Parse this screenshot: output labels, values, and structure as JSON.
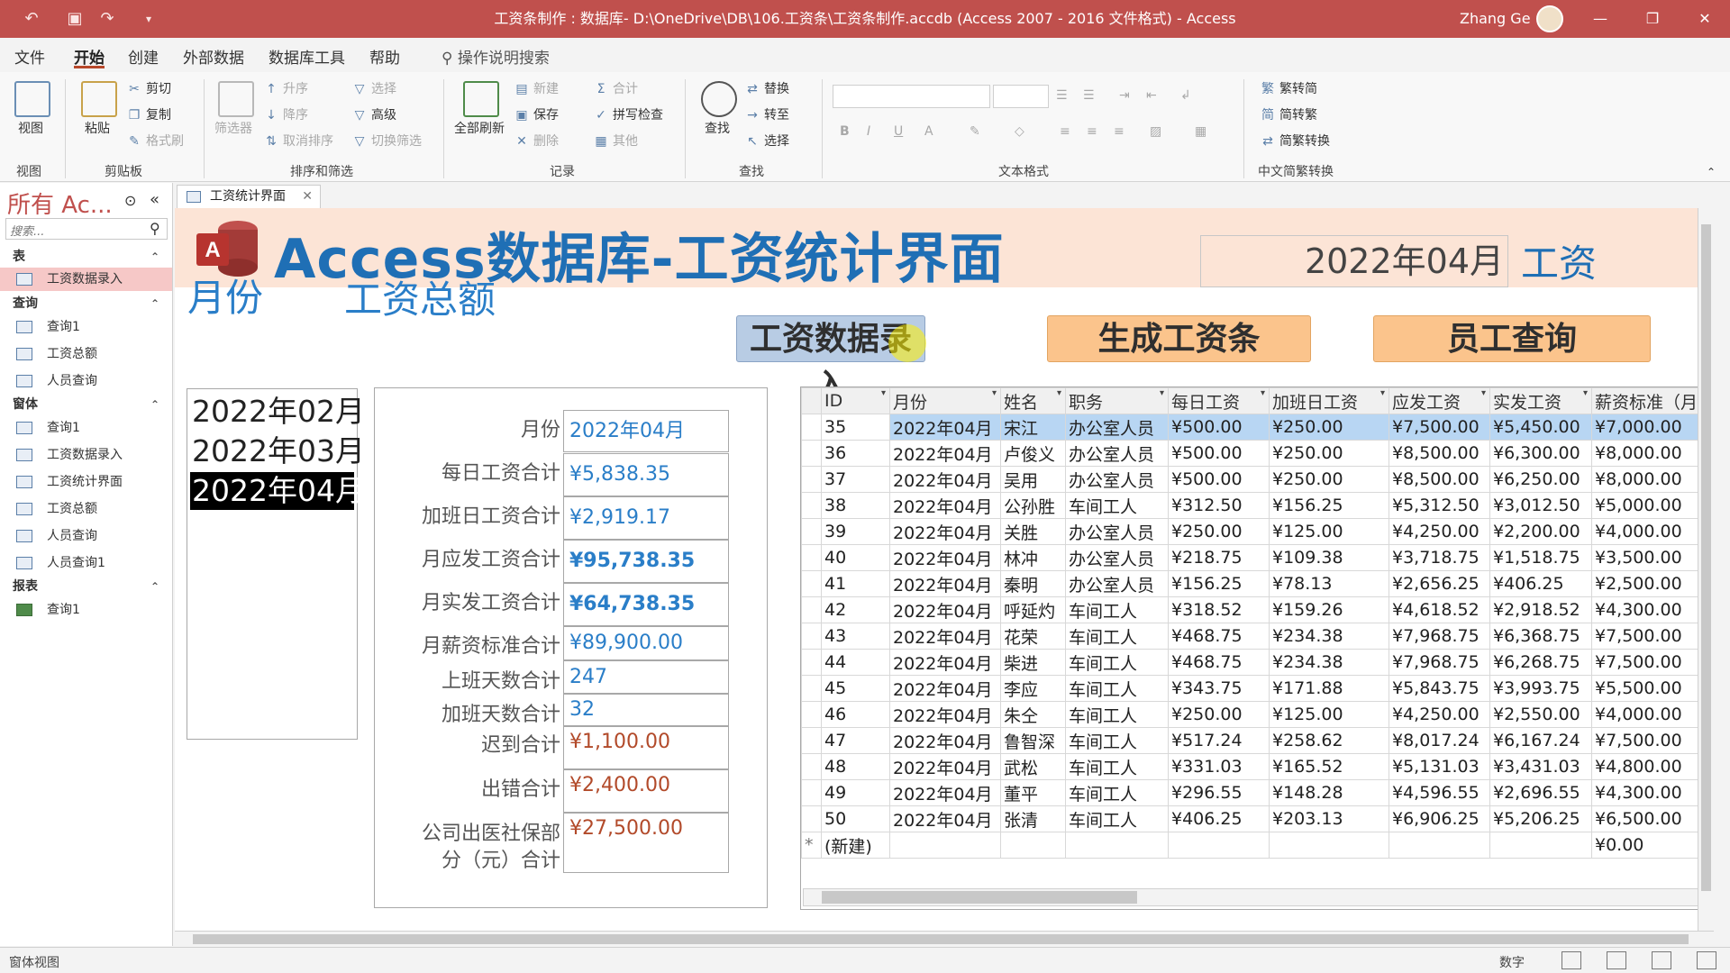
{
  "window": {
    "title": "工资条制作 : 数据库- D:\\OneDrive\\DB\\106.工资条\\工资条制作.accdb (Access 2007 - 2016 文件格式) - Access",
    "user": "Zhang Ge"
  },
  "menu": {
    "tabs": [
      "文件",
      "开始",
      "创建",
      "外部数据",
      "数据库工具",
      "帮助"
    ],
    "tell_me": "操作说明搜索"
  },
  "ribbon": {
    "view": "视图",
    "paste": "粘贴",
    "cut": "剪切",
    "copy": "复制",
    "format_painter": "格式刷",
    "filter": "筛选器",
    "asc": "升序",
    "desc": "降序",
    "clear_sort": "取消排序",
    "select": "选择",
    "advanced": "高级",
    "toggle_filter": "切换筛选",
    "refresh_all": "全部刷新",
    "new": "新建",
    "save": "保存",
    "delete": "删除",
    "totals": "合计",
    "spelling": "拼写检查",
    "more": "其他",
    "find": "查找",
    "replace": "替换",
    "goto": "转至",
    "select2": "选择",
    "trad": "繁转简",
    "simp": "简转繁",
    "convert": "简繁转换",
    "groups": {
      "view": "视图",
      "clipboard": "剪贴板",
      "sort_filter": "排序和筛选",
      "records": "记录",
      "find": "查找",
      "text_format": "文本格式",
      "chinese": "中文简繁转换"
    }
  },
  "nav": {
    "title": "所有 Ac...",
    "search_placeholder": "搜索...",
    "sections": {
      "tables": "表",
      "queries": "查询",
      "forms": "窗体",
      "reports": "报表"
    },
    "tables": [
      "工资数据录入"
    ],
    "queries": [
      "查询1",
      "工资总额",
      "人员查询"
    ],
    "forms": [
      "查询1",
      "工资数据录入",
      "工资统计界面",
      "工资总额",
      "人员查询",
      "人员查询1"
    ],
    "reports": [
      "查询1"
    ]
  },
  "doc_tab": "工资统计界面",
  "form": {
    "title": "Access数据库-工资统计界面",
    "month_display": "2022年04月",
    "salary_label": "工资",
    "month_label": "月份",
    "total_label": "工资总额",
    "buttons": {
      "entry": "工资数据录入",
      "slip": "生成工资条",
      "query": "员工查询"
    },
    "months": [
      "2022年02月",
      "2022年03月",
      "2022年04月"
    ],
    "summary": [
      {
        "label": "月份",
        "value": "2022年04月"
      },
      {
        "label": "每日工资合计",
        "value": "¥5,838.35"
      },
      {
        "label": "加班日工资合计",
        "value": "¥2,919.17"
      },
      {
        "label": "月应发工资合计",
        "value": "¥95,738.35"
      },
      {
        "label": "月实发工资合计",
        "value": "¥64,738.35"
      },
      {
        "label": "月薪资标准合计",
        "value": "¥89,900.00"
      },
      {
        "label": "上班天数合计",
        "value": "247"
      },
      {
        "label": "加班天数合计",
        "value": "32"
      },
      {
        "label": "迟到合计",
        "value": "¥1,100.00"
      },
      {
        "label": "出错合计",
        "value": "¥2,400.00"
      },
      {
        "label": "公司出医社保部",
        "value": "¥27,500.00"
      },
      {
        "label": "分（元）合计",
        "value": ""
      }
    ]
  },
  "datasheet": {
    "columns": [
      "ID",
      "月份",
      "姓名",
      "职务",
      "每日工资",
      "加班日工资",
      "应发工资",
      "实发工资",
      "薪资标准（月/"
    ],
    "rows": [
      [
        "35",
        "2022年04月",
        "宋江",
        "办公室人员",
        "¥500.00",
        "¥250.00",
        "¥7,500.00",
        "¥5,450.00",
        "¥7,000.00"
      ],
      [
        "36",
        "2022年04月",
        "卢俊义",
        "办公室人员",
        "¥500.00",
        "¥250.00",
        "¥8,500.00",
        "¥6,300.00",
        "¥8,000.00"
      ],
      [
        "37",
        "2022年04月",
        "吴用",
        "办公室人员",
        "¥500.00",
        "¥250.00",
        "¥8,500.00",
        "¥6,250.00",
        "¥8,000.00"
      ],
      [
        "38",
        "2022年04月",
        "公孙胜",
        "车间工人",
        "¥312.50",
        "¥156.25",
        "¥5,312.50",
        "¥3,012.50",
        "¥5,000.00"
      ],
      [
        "39",
        "2022年04月",
        "关胜",
        "办公室人员",
        "¥250.00",
        "¥125.00",
        "¥4,250.00",
        "¥2,200.00",
        "¥4,000.00"
      ],
      [
        "40",
        "2022年04月",
        "林冲",
        "办公室人员",
        "¥218.75",
        "¥109.38",
        "¥3,718.75",
        "¥1,518.75",
        "¥3,500.00"
      ],
      [
        "41",
        "2022年04月",
        "秦明",
        "办公室人员",
        "¥156.25",
        "¥78.13",
        "¥2,656.25",
        "¥406.25",
        "¥2,500.00"
      ],
      [
        "42",
        "2022年04月",
        "呼延灼",
        "车间工人",
        "¥318.52",
        "¥159.26",
        "¥4,618.52",
        "¥2,918.52",
        "¥4,300.00"
      ],
      [
        "43",
        "2022年04月",
        "花荣",
        "车间工人",
        "¥468.75",
        "¥234.38",
        "¥7,968.75",
        "¥6,368.75",
        "¥7,500.00"
      ],
      [
        "44",
        "2022年04月",
        "柴进",
        "车间工人",
        "¥468.75",
        "¥234.38",
        "¥7,968.75",
        "¥6,268.75",
        "¥7,500.00"
      ],
      [
        "45",
        "2022年04月",
        "李应",
        "车间工人",
        "¥343.75",
        "¥171.88",
        "¥5,843.75",
        "¥3,993.75",
        "¥5,500.00"
      ],
      [
        "46",
        "2022年04月",
        "朱仝",
        "车间工人",
        "¥250.00",
        "¥125.00",
        "¥4,250.00",
        "¥2,550.00",
        "¥4,000.00"
      ],
      [
        "47",
        "2022年04月",
        "鲁智深",
        "车间工人",
        "¥517.24",
        "¥258.62",
        "¥8,017.24",
        "¥6,167.24",
        "¥7,500.00"
      ],
      [
        "48",
        "2022年04月",
        "武松",
        "车间工人",
        "¥331.03",
        "¥165.52",
        "¥5,131.03",
        "¥3,431.03",
        "¥4,800.00"
      ],
      [
        "49",
        "2022年04月",
        "董平",
        "车间工人",
        "¥296.55",
        "¥148.28",
        "¥4,596.55",
        "¥2,696.55",
        "¥4,300.00"
      ],
      [
        "50",
        "2022年04月",
        "张清",
        "车间工人",
        "¥406.25",
        "¥203.13",
        "¥6,906.25",
        "¥5,206.25",
        "¥6,500.00"
      ]
    ],
    "new_row_label": "(新建)",
    "new_row_marker": "*",
    "new_row_default": "¥0.00"
  },
  "status": {
    "left": "窗体视图",
    "num": "数字"
  },
  "colors": {
    "titlebar": "#c0504d",
    "title_blue": "#1f6fb5",
    "header_bg": "#fce4d6",
    "button_orange": "#fbc48c",
    "button_blue": "#b8cce4"
  }
}
